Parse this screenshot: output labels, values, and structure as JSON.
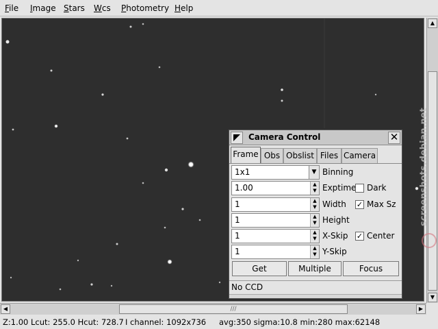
{
  "menubar": {
    "items": [
      "File",
      "Image",
      "Stars",
      "Wcs",
      "Photometry",
      "Help"
    ]
  },
  "camera": {
    "title": "Camera Control",
    "tabs": [
      "Frame",
      "Obs",
      "Obslist",
      "Files",
      "Camera"
    ],
    "active_tab": "Frame",
    "binning": {
      "value": "1x1",
      "label": "Binning"
    },
    "exptime": {
      "value": "1.00",
      "label": "Exptime"
    },
    "width": {
      "value": "1",
      "label": "Width"
    },
    "height": {
      "value": "1",
      "label": "Height"
    },
    "xskip": {
      "value": "1",
      "label": "X-Skip"
    },
    "yskip": {
      "value": "1",
      "label": "Y-Skip"
    },
    "dark": {
      "label": "Dark",
      "checked": false
    },
    "maxsz": {
      "label": "Max Sz",
      "checked": true
    },
    "center": {
      "label": "Center",
      "checked": true
    },
    "buttons": {
      "get": "Get",
      "multiple": "Multiple",
      "focus": "Focus"
    },
    "status": "No CCD"
  },
  "statusbar": {
    "zoom_cuts": "Z:1.00 Lcut: 255.0 Hcut: 728.7",
    "channel": "I channel: 1092x736",
    "stats": "avg:350 sigma:10.8 min:280 max:62148"
  },
  "hscroll": {
    "grip": "///"
  },
  "watermark": "screenshots.debian.net",
  "colors": {
    "sky": "#2e2e2e",
    "window_bg": "#e4e4e4"
  }
}
